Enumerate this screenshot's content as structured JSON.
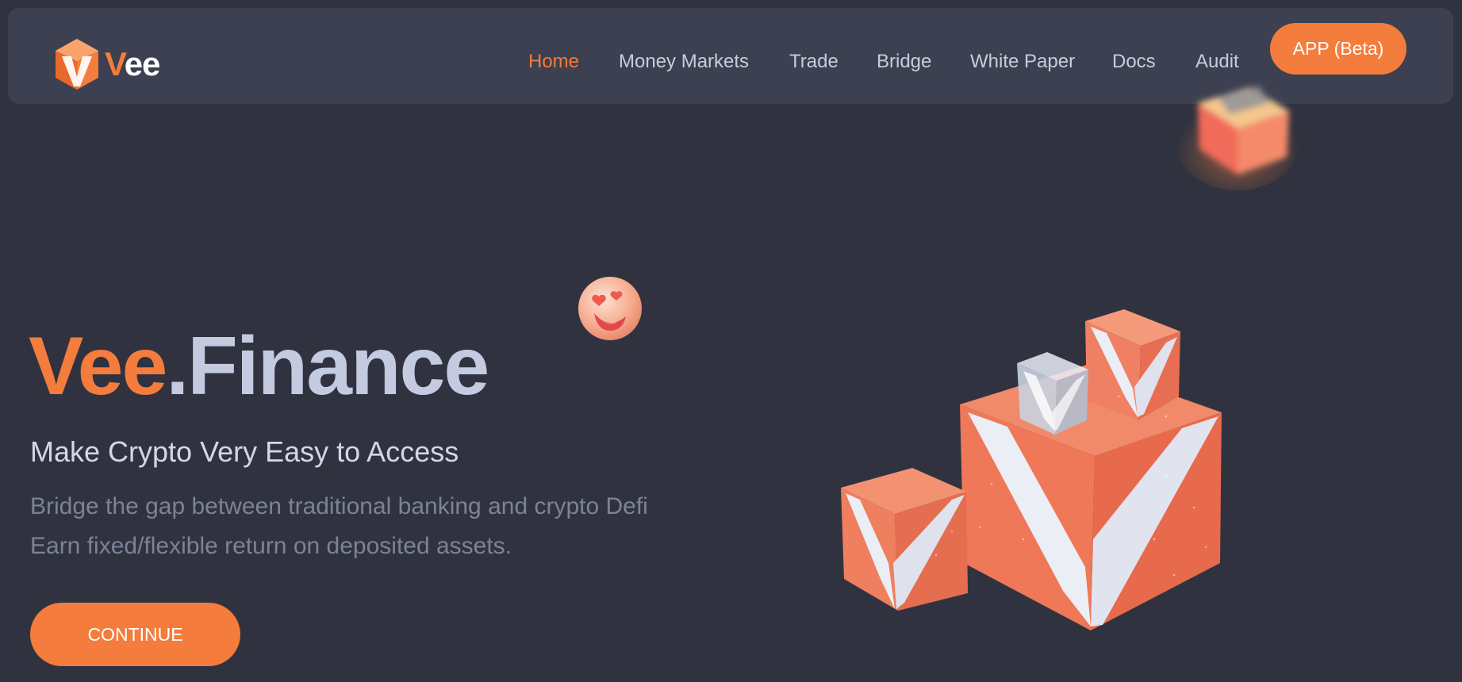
{
  "brand": {
    "logo_letter": "V",
    "logo_rest": "ee",
    "accent_color": "#f47c3c",
    "logo_icon": "vee-hexagon-logo-icon"
  },
  "nav": {
    "links": [
      {
        "label": "Home",
        "active": true
      },
      {
        "label": "Money Markets",
        "active": false
      },
      {
        "label": "Trade",
        "active": false
      },
      {
        "label": "Bridge",
        "active": false
      },
      {
        "label": "White Paper",
        "active": false
      },
      {
        "label": "Docs",
        "active": false
      },
      {
        "label": "Audit",
        "active": false
      }
    ],
    "app_button": "APP (Beta)"
  },
  "hero": {
    "title_brand": "Vee",
    "title_rest": ".Finance",
    "subtitle": "Make Crypto Very Easy to Access",
    "description_line1": "Bridge the gap between traditional banking and crypto Defi",
    "description_line2": "Earn fixed/flexible return on deposited assets.",
    "cta": "CONTINUE"
  },
  "illustrations": {
    "emoji": "heart-eyes-emoji-ball-icon",
    "floating_cube": "floating-orange-cube-icon",
    "cubes": "orange-v-cubes-illustration"
  }
}
